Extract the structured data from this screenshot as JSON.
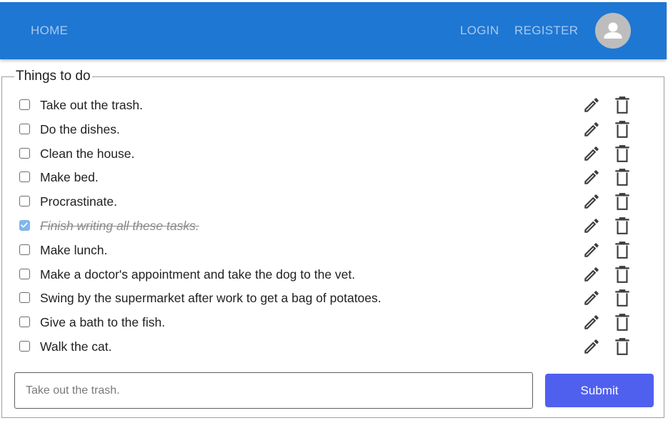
{
  "nav": {
    "home": "HOME",
    "login": "LOGIN",
    "register": "REGISTER",
    "avatar_icon": "user-avatar-icon"
  },
  "colors": {
    "appbar": "#1e77d3",
    "nav_text": "#a9c8ef",
    "submit": "#5060ee",
    "checked": "#7fb6ec"
  },
  "todo": {
    "legend": "Things to do",
    "tasks": [
      {
        "label": "Take out the trash.",
        "done": false
      },
      {
        "label": "Do the dishes.",
        "done": false
      },
      {
        "label": "Clean the house.",
        "done": false
      },
      {
        "label": "Make bed.",
        "done": false
      },
      {
        "label": "Procrastinate.",
        "done": false
      },
      {
        "label": "Finish writing all these tasks.",
        "done": true
      },
      {
        "label": "Make lunch.",
        "done": false
      },
      {
        "label": "Make a doctor's appointment and take the dog to the vet.",
        "done": false
      },
      {
        "label": "Swing by the supermarket after work to get a bag of potatoes.",
        "done": false
      },
      {
        "label": "Give a bath to the fish.",
        "done": false
      },
      {
        "label": "Walk the cat.",
        "done": false
      }
    ],
    "row_icons": {
      "edit": "pencil-icon",
      "delete": "trash-icon"
    }
  },
  "form": {
    "placeholder": "Take out the trash.",
    "value": "",
    "submit_label": "Submit"
  }
}
